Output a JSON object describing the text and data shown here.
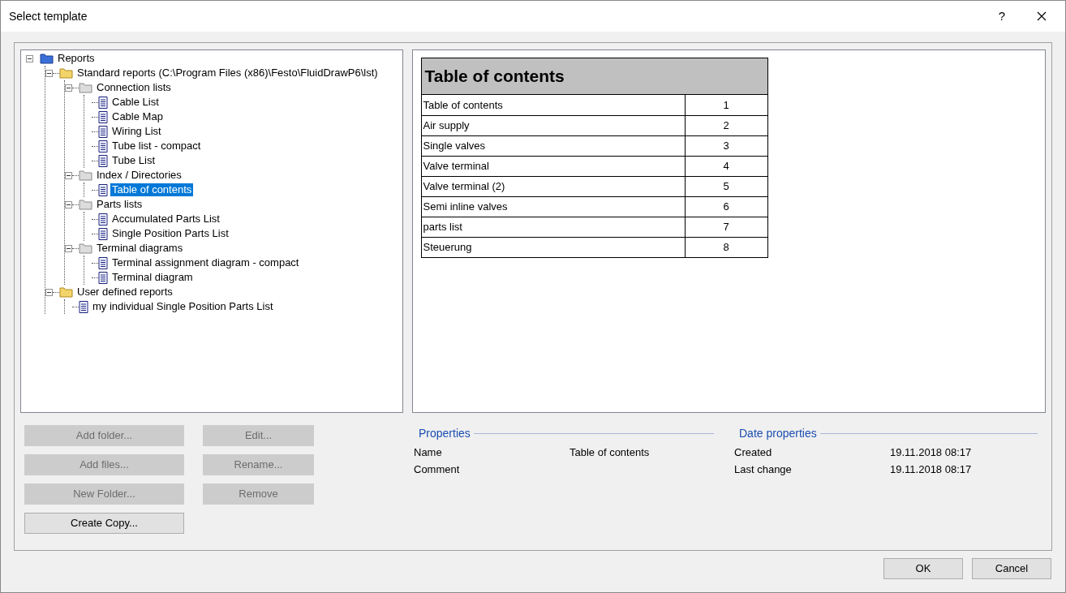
{
  "window": {
    "title": "Select template",
    "help": "?"
  },
  "tree": [
    {
      "label": "Reports",
      "kind": "root",
      "expanded": true,
      "children": [
        {
          "label": "Standard reports (C:\\Program Files (x86)\\Festo\\FluidDrawP6\\lst)",
          "kind": "folder",
          "expanded": true,
          "children": [
            {
              "label": "Connection lists",
              "kind": "group",
              "expanded": true,
              "children": [
                {
                  "label": "Cable List",
                  "kind": "document",
                  "selected": false
                },
                {
                  "label": "Cable Map",
                  "kind": "document",
                  "selected": false
                },
                {
                  "label": "Wiring List",
                  "kind": "document",
                  "selected": false
                },
                {
                  "label": "Tube list - compact",
                  "kind": "document",
                  "selected": false
                },
                {
                  "label": "Tube List",
                  "kind": "document",
                  "selected": false
                }
              ]
            },
            {
              "label": "Index / Directories",
              "kind": "group",
              "expanded": true,
              "children": [
                {
                  "label": "Table of contents",
                  "kind": "document",
                  "selected": true
                }
              ]
            },
            {
              "label": "Parts lists",
              "kind": "group",
              "expanded": true,
              "children": [
                {
                  "label": "Accumulated Parts List",
                  "kind": "document",
                  "selected": false
                },
                {
                  "label": "Single Position Parts List",
                  "kind": "document",
                  "selected": false
                }
              ]
            },
            {
              "label": "Terminal diagrams",
              "kind": "group",
              "expanded": true,
              "children": [
                {
                  "label": "Terminal assignment diagram - compact",
                  "kind": "document",
                  "selected": false
                },
                {
                  "label": "Terminal diagram",
                  "kind": "document",
                  "selected": false
                }
              ]
            }
          ]
        },
        {
          "label": "User defined reports",
          "kind": "folder",
          "expanded": true,
          "children": [
            {
              "label": "my individual Single Position Parts List",
              "kind": "document",
              "selected": false
            }
          ]
        }
      ]
    }
  ],
  "preview": {
    "title": "Table of contents",
    "rows": [
      [
        "Table of contents",
        "1"
      ],
      [
        "Air supply",
        "2"
      ],
      [
        "Single valves",
        "3"
      ],
      [
        "Valve terminal",
        "4"
      ],
      [
        "Valve terminal (2)",
        "5"
      ],
      [
        "Semi inline valves",
        "6"
      ],
      [
        "parts list",
        "7"
      ],
      [
        "Steuerung",
        "8"
      ]
    ]
  },
  "buttons_left": [
    {
      "label": "Add folder...",
      "disabled": true
    },
    {
      "label": "Add files...",
      "disabled": true
    },
    {
      "label": "New Folder...",
      "disabled": true
    },
    {
      "label": "Create Copy...",
      "disabled": false
    }
  ],
  "buttons_right": [
    {
      "label": "Edit...",
      "disabled": true
    },
    {
      "label": "Rename...",
      "disabled": true
    },
    {
      "label": "Remove",
      "disabled": true
    }
  ],
  "properties": {
    "heading": "Properties",
    "rows": [
      {
        "label": "Name",
        "value": "Table of contents"
      },
      {
        "label": "Comment"
      }
    ]
  },
  "date_properties": {
    "heading": "Date properties",
    "rows": [
      {
        "label": "Created",
        "value": "19.11.2018 08:17"
      },
      {
        "label": "Last change",
        "value": "19.11.2018 08:17"
      }
    ]
  },
  "dialog_buttons": [
    {
      "label": "OK"
    },
    {
      "label": "Cancel"
    }
  ]
}
